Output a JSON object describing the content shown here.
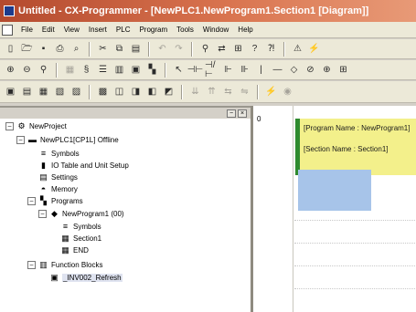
{
  "window": {
    "title": "Untitled - CX-Programmer - [NewPLC1.NewProgram1.Section1 [Diagram]]"
  },
  "menubar": {
    "items": [
      "File",
      "Edit",
      "View",
      "Insert",
      "PLC",
      "Program",
      "Tools",
      "Window",
      "Help"
    ]
  },
  "toolbar1": {
    "buttons": [
      {
        "icon": "new-icon",
        "glyph": "▯"
      },
      {
        "icon": "open-icon",
        "glyph": "🗁"
      },
      {
        "icon": "save-icon",
        "glyph": "▪"
      },
      {
        "icon": "print-icon",
        "glyph": "⎙"
      },
      {
        "icon": "print-preview-icon",
        "glyph": "⌕"
      },
      {
        "icon": "cut-icon",
        "glyph": "✂"
      },
      {
        "icon": "copy-icon",
        "glyph": "⧉"
      },
      {
        "icon": "paste-icon",
        "glyph": "▤"
      },
      {
        "icon": "undo-icon",
        "glyph": "↶"
      },
      {
        "icon": "redo-icon",
        "glyph": "↷"
      },
      {
        "icon": "find-icon",
        "glyph": "⚲"
      },
      {
        "icon": "replace-icon",
        "glyph": "⇄"
      },
      {
        "icon": "cross-reference-icon",
        "glyph": "⊞"
      },
      {
        "icon": "help-icon",
        "glyph": "?"
      },
      {
        "icon": "whats-this-icon",
        "glyph": "⁈"
      },
      {
        "icon": "warning-icon",
        "glyph": "⚠"
      },
      {
        "icon": "online-icon",
        "glyph": "⚡"
      }
    ]
  },
  "toolbar2": {
    "buttons": [
      {
        "icon": "zoom-in-icon",
        "glyph": "⊕"
      },
      {
        "icon": "zoom-out-icon",
        "glyph": "⊖"
      },
      {
        "icon": "zoom-icon",
        "glyph": "⚲"
      },
      {
        "icon": "grid-icon",
        "glyph": "▦"
      },
      {
        "icon": "symbols-toggle-icon",
        "glyph": "§"
      },
      {
        "icon": "list-icon",
        "glyph": "☰"
      },
      {
        "icon": "table-icon",
        "glyph": "▥"
      },
      {
        "icon": "monitor-icon",
        "glyph": "▣"
      },
      {
        "icon": "program-icon",
        "glyph": "▚"
      },
      {
        "icon": "select-icon",
        "glyph": "↖"
      },
      {
        "icon": "contact-no-icon",
        "glyph": "⊣⊢"
      },
      {
        "icon": "contact-nc-icon",
        "glyph": "⊣/⊢"
      },
      {
        "icon": "contact-or-icon",
        "glyph": "⊩"
      },
      {
        "icon": "contact-or-nc-icon",
        "glyph": "⊪"
      },
      {
        "icon": "vertical-line-icon",
        "glyph": "|"
      },
      {
        "icon": "horizontal-line-icon",
        "glyph": "—"
      },
      {
        "icon": "coil-icon",
        "glyph": "◇"
      },
      {
        "icon": "coil-nc-icon",
        "glyph": "⊘"
      },
      {
        "icon": "instruction-icon",
        "glyph": "⊕"
      },
      {
        "icon": "function-block-icon",
        "glyph": "⊞"
      }
    ]
  },
  "toolbar3": {
    "buttons": [
      {
        "icon": "project-workspace-icon",
        "glyph": "▣"
      },
      {
        "icon": "output-window-icon",
        "glyph": "▤"
      },
      {
        "icon": "watch-window-icon",
        "glyph": "▦"
      },
      {
        "icon": "address-reference-icon",
        "glyph": "▧"
      },
      {
        "icon": "properties-icon",
        "glyph": "▨"
      },
      {
        "icon": "cross-ref-report-icon",
        "glyph": "▩"
      },
      {
        "icon": "memory-icon",
        "glyph": "◫"
      },
      {
        "icon": "io-comment-icon",
        "glyph": "◨"
      },
      {
        "icon": "symbols-icon",
        "glyph": "◧"
      },
      {
        "icon": "io-table-icon",
        "glyph": "◩"
      },
      {
        "icon": "compile-icon",
        "glyph": "⇊"
      },
      {
        "icon": "compile-all-icon",
        "glyph": "⇈"
      },
      {
        "icon": "transfer-icon",
        "glyph": "⇆"
      },
      {
        "icon": "compare-icon",
        "glyph": "⇋"
      },
      {
        "icon": "work-online-icon",
        "glyph": "⚡"
      },
      {
        "icon": "mode-icon",
        "glyph": "◉"
      }
    ]
  },
  "project_tree": {
    "pane_controls": [
      "−",
      "×"
    ],
    "nodes": [
      {
        "label": "NewProject",
        "icon": "project-icon",
        "glyph": "⚙",
        "expander": "−",
        "level": 0
      },
      {
        "label": "NewPLC1[CP1L] Offline",
        "icon": "plc-icon",
        "glyph": "▬",
        "expander": "−",
        "level": 1
      },
      {
        "label": "Symbols",
        "icon": "symbols-icon",
        "glyph": "≡",
        "expander": "",
        "level": 2
      },
      {
        "label": "IO Table and Unit Setup",
        "icon": "io-table-icon",
        "glyph": "▮",
        "expander": "",
        "level": 2
      },
      {
        "label": "Settings",
        "icon": "settings-icon",
        "glyph": "▤",
        "expander": "",
        "level": 2
      },
      {
        "label": "Memory",
        "icon": "memory-icon",
        "glyph": "◓",
        "expander": "",
        "level": 2
      },
      {
        "label": "Programs",
        "icon": "programs-icon",
        "glyph": "▚",
        "expander": "−",
        "level": 2
      },
      {
        "label": "NewProgram1 (00)",
        "icon": "program-icon",
        "glyph": "◆",
        "expander": "−",
        "level": 3
      },
      {
        "label": "Symbols",
        "icon": "symbols-icon",
        "glyph": "≡",
        "expander": "",
        "level": 4
      },
      {
        "label": "Section1",
        "icon": "section-icon",
        "glyph": "▦",
        "expander": "",
        "level": 4
      },
      {
        "label": "END",
        "icon": "end-icon",
        "glyph": "▦",
        "expander": "",
        "level": 4
      },
      {
        "label": "Function Blocks",
        "icon": "function-blocks-icon",
        "glyph": "▥",
        "expander": "−",
        "level": 2
      },
      {
        "label": "_INV002_Refresh",
        "icon": "function-block-icon",
        "glyph": "▣",
        "expander": "",
        "level": 3
      }
    ]
  },
  "diagram": {
    "rung_number": "0",
    "program_name": "[Program Name : NewProgram1]",
    "section_name": "[Section Name : Section1]"
  }
}
